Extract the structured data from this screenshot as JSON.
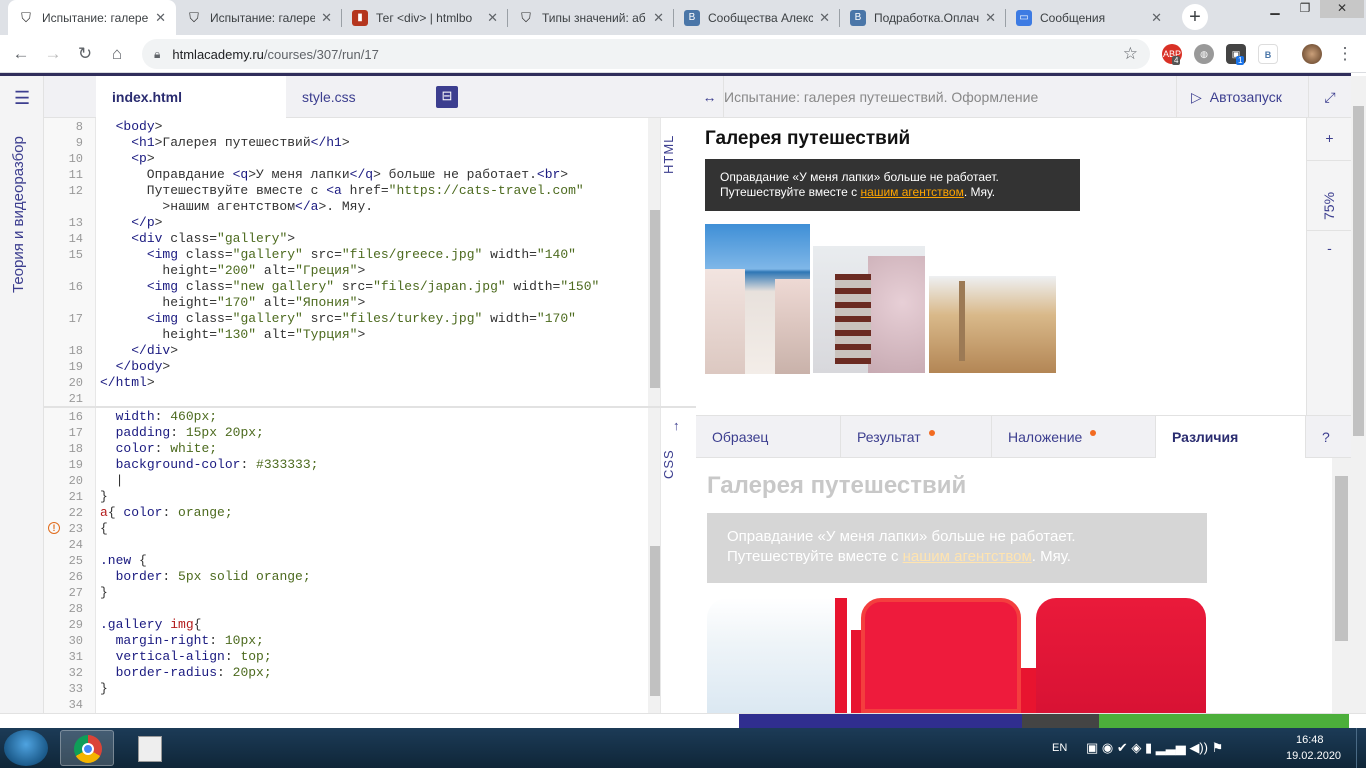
{
  "browser": {
    "tabs": [
      {
        "title": "Испытание: галере",
        "favicon": "htmlacademy-shield-icon",
        "active": true
      },
      {
        "title": "Испытание: галере",
        "favicon": "htmlacademy-shield-icon"
      },
      {
        "title": "Тег <div> | htmlbo",
        "favicon": "htmlbook-icon"
      },
      {
        "title": "Типы значений: аб",
        "favicon": "htmlacademy-shield-icon"
      },
      {
        "title": "Сообщества Алекс",
        "favicon": "vk-icon"
      },
      {
        "title": "Подработка.Оплач",
        "favicon": "vk-icon"
      },
      {
        "title": "Сообщения",
        "favicon": "messages-icon"
      }
    ],
    "url_host": "htmlacademy.ru",
    "url_path": "/courses/307/run/17",
    "ext_badges": {
      "abp": "4",
      "cube": "1"
    }
  },
  "sidebar": {
    "vertical_label": "Теория и видеоразбор"
  },
  "editor": {
    "tabs": [
      "index.html",
      "style.css"
    ],
    "html_label": "HTML",
    "css_label": "CSS",
    "html_lines": [
      {
        "n": "8",
        "code": "  <body>"
      },
      {
        "n": "9",
        "code": "    <h1>Галерея путешествий</h1>"
      },
      {
        "n": "10",
        "code": "    <p>"
      },
      {
        "n": "11",
        "code": "      Оправдание <q>У меня лапки</q> больше не работает.<br>"
      },
      {
        "n": "12",
        "code": "      Путешествуйте вместе с <a href=\"https://cats-travel.com\""
      },
      {
        "n": "",
        "code": "        >нашим агентством</a>. Мяу."
      },
      {
        "n": "13",
        "code": "    </p>"
      },
      {
        "n": "14",
        "code": "    <div class=\"gallery\">"
      },
      {
        "n": "15",
        "code": "      <img class=\"gallery\" src=\"files/greece.jpg\" width=\"140\""
      },
      {
        "n": "",
        "code": "        height=\"200\" alt=\"Греция\">"
      },
      {
        "n": "16",
        "code": "      <img class=\"new gallery\" src=\"files/japan.jpg\" width=\"150\""
      },
      {
        "n": "",
        "code": "        height=\"170\" alt=\"Япония\">"
      },
      {
        "n": "17",
        "code": "      <img class=\"gallery\" src=\"files/turkey.jpg\" width=\"170\""
      },
      {
        "n": "",
        "code": "        height=\"130\" alt=\"Турция\">"
      },
      {
        "n": "18",
        "code": "    </div>"
      },
      {
        "n": "19",
        "code": "  </body>"
      },
      {
        "n": "20",
        "code": "</html>"
      },
      {
        "n": "21",
        "code": ""
      }
    ],
    "css_lines": [
      {
        "n": "16",
        "code": "  width: 460px;"
      },
      {
        "n": "17",
        "code": "  padding: 15px 20px;"
      },
      {
        "n": "18",
        "code": "  color: white;"
      },
      {
        "n": "19",
        "code": "  background-color: #333333;"
      },
      {
        "n": "20",
        "code": "  |"
      },
      {
        "n": "21",
        "code": "}"
      },
      {
        "n": "22",
        "code": "a{ color: orange;"
      },
      {
        "n": "23",
        "code": "{"
      },
      {
        "n": "24",
        "code": ""
      },
      {
        "n": "25",
        "code": ".new {"
      },
      {
        "n": "26",
        "code": "  border: 5px solid orange;"
      },
      {
        "n": "27",
        "code": "}"
      },
      {
        "n": "28",
        "code": ""
      },
      {
        "n": "29",
        "code": ".gallery img{"
      },
      {
        "n": "30",
        "code": "  margin-right: 10px;"
      },
      {
        "n": "31",
        "code": "  vertical-align: top;"
      },
      {
        "n": "32",
        "code": "  border-radius: 20px;"
      },
      {
        "n": "33",
        "code": "}"
      },
      {
        "n": "34",
        "code": ""
      }
    ]
  },
  "preview": {
    "title": "Испытание: галерея путешествий. Оформление",
    "autorun": "Автозапуск",
    "zoom": "75%",
    "heading": "Галерея путешествий",
    "p_line1": "Оправдание «У меня лапки» больше не работает.",
    "p_line2a": "Путешествуйте вместе с ",
    "p_link": "нашим агентством",
    "p_line2b": ". Мяу."
  },
  "compare_tabs": [
    "Образец",
    "Результат",
    "Наложение",
    "Различия",
    "?"
  ],
  "taskbar": {
    "lang": "EN",
    "time": "16:48",
    "date": "19.02.2020"
  }
}
